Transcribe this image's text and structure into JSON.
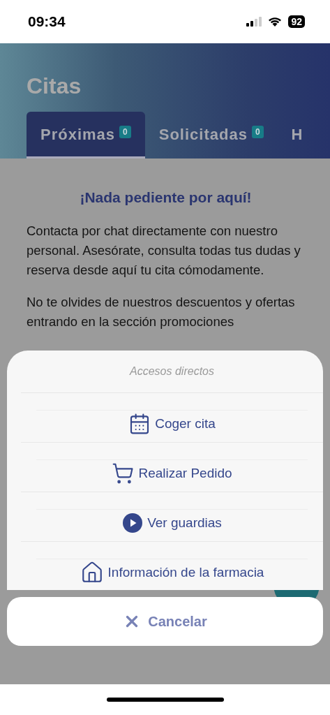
{
  "status_bar": {
    "time": "09:34",
    "battery": "92"
  },
  "header": {
    "title": "Citas",
    "tabs": [
      {
        "label": "Próximas",
        "count": "0",
        "selected": true
      },
      {
        "label": "Solicitadas",
        "count": "0",
        "selected": false
      },
      {
        "label": "H",
        "selected": false
      }
    ]
  },
  "empty_state": {
    "heading": "¡Nada pediente por aquí!",
    "paragraphs": [
      "Contacta por chat directamente con nuestro personal. Asesórate, consulta todas tus dudas y reserva desde aquí tu cita cómodamente.",
      "No te olvides de nuestros descuentos y ofertas entrando en la sección promociones"
    ]
  },
  "action_sheet": {
    "title": "Accesos directos",
    "actions": [
      {
        "kind": "calendar",
        "label": "Coger cita"
      },
      {
        "kind": "cart",
        "label": "Realizar Pedido"
      },
      {
        "kind": "play",
        "label": "Ver guardias"
      },
      {
        "kind": "house",
        "label": "Información de la farmacia"
      }
    ],
    "cancel": "Cancelar"
  }
}
